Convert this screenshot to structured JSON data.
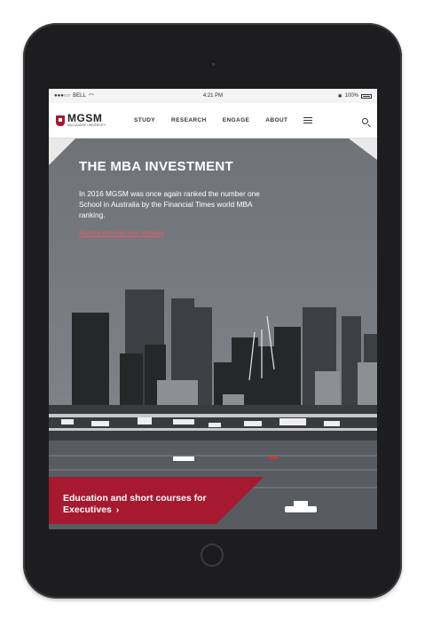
{
  "status_bar": {
    "carrier": "BELL",
    "time": "4:21 PM",
    "battery": "100%"
  },
  "nav": {
    "logo_text": "MGSM",
    "logo_subtext": "MACQUARIE UNIVERSITY",
    "links": [
      "STUDY",
      "RESEARCH",
      "ENGAGE",
      "ABOUT"
    ]
  },
  "hero": {
    "title": "THE MBA INVESTMENT",
    "body": "In 2016 MGSM was once again ranked the number one School in Australia by the Financial Times world MBA ranking.",
    "link": "Alumni discuss our ranking"
  },
  "cta": {
    "line1": "Education and short courses for",
    "line2": "Executives",
    "chevron": "›"
  },
  "colors": {
    "brand_red": "#a6192e",
    "link_red": "#e25a6b"
  }
}
